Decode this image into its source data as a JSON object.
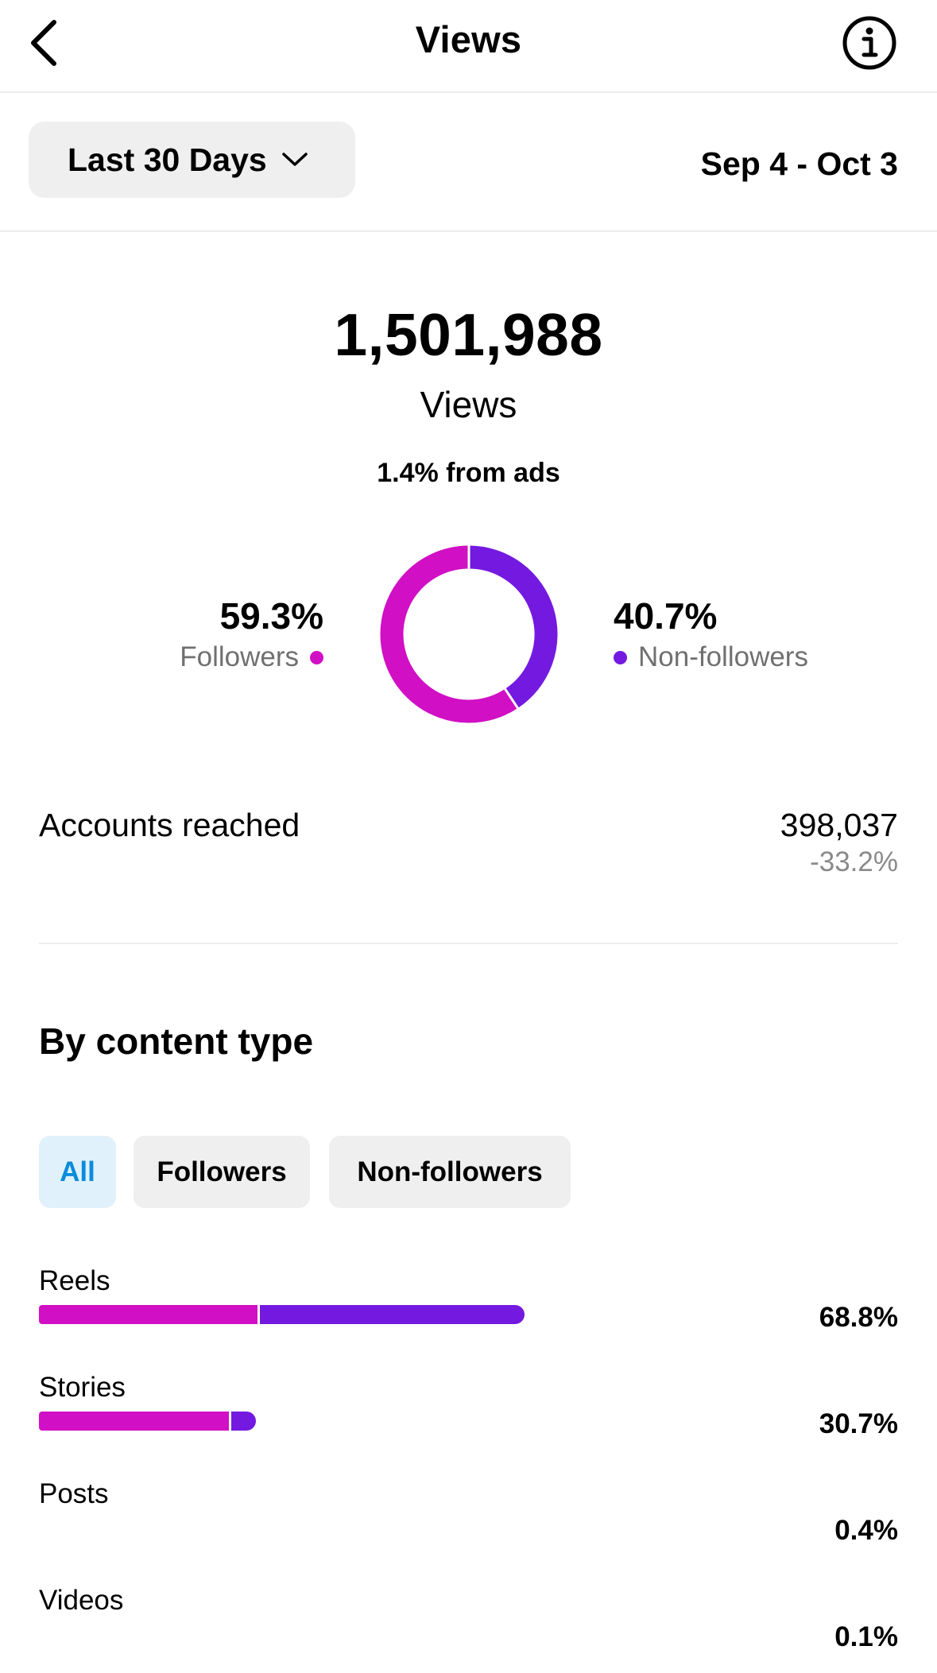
{
  "header": {
    "title": "Views",
    "back_icon": "chevron-left-icon",
    "info_icon": "info-icon"
  },
  "range": {
    "label": "Last 30 Days",
    "dates": "Sep 4 - Oct 3"
  },
  "summary": {
    "total": "1,501,988",
    "label": "Views",
    "ads_note": "1.4% from ads"
  },
  "split": {
    "followers_pct": "59.3%",
    "followers_label": "Followers",
    "followers_fraction": 0.593,
    "nonfollowers_pct": "40.7%",
    "nonfollowers_label": "Non-followers",
    "nonfollowers_fraction": 0.407
  },
  "colors": {
    "followers": "#d10fc4",
    "nonfollowers": "#7419e0",
    "chip_active_bg": "#e1f1fb",
    "chip_active_text": "#0a8cdc"
  },
  "accounts": {
    "label": "Accounts reached",
    "value": "398,037",
    "change": "-33.2%"
  },
  "content_type": {
    "title": "By content type",
    "filters": [
      {
        "label": "All",
        "active": true
      },
      {
        "label": "Followers",
        "active": false
      },
      {
        "label": "Non-followers",
        "active": false
      }
    ],
    "rows": [
      {
        "label": "Reels",
        "pct": "68.8%",
        "share": 0.688,
        "followers_part": 0.45
      },
      {
        "label": "Stories",
        "pct": "30.7%",
        "share": 0.307,
        "followers_part": 0.875
      },
      {
        "label": "Posts",
        "pct": "0.4%",
        "share": 0.004,
        "followers_part": 0.5
      },
      {
        "label": "Videos",
        "pct": "0.1%",
        "share": 0.001,
        "followers_part": 0.5
      }
    ]
  }
}
